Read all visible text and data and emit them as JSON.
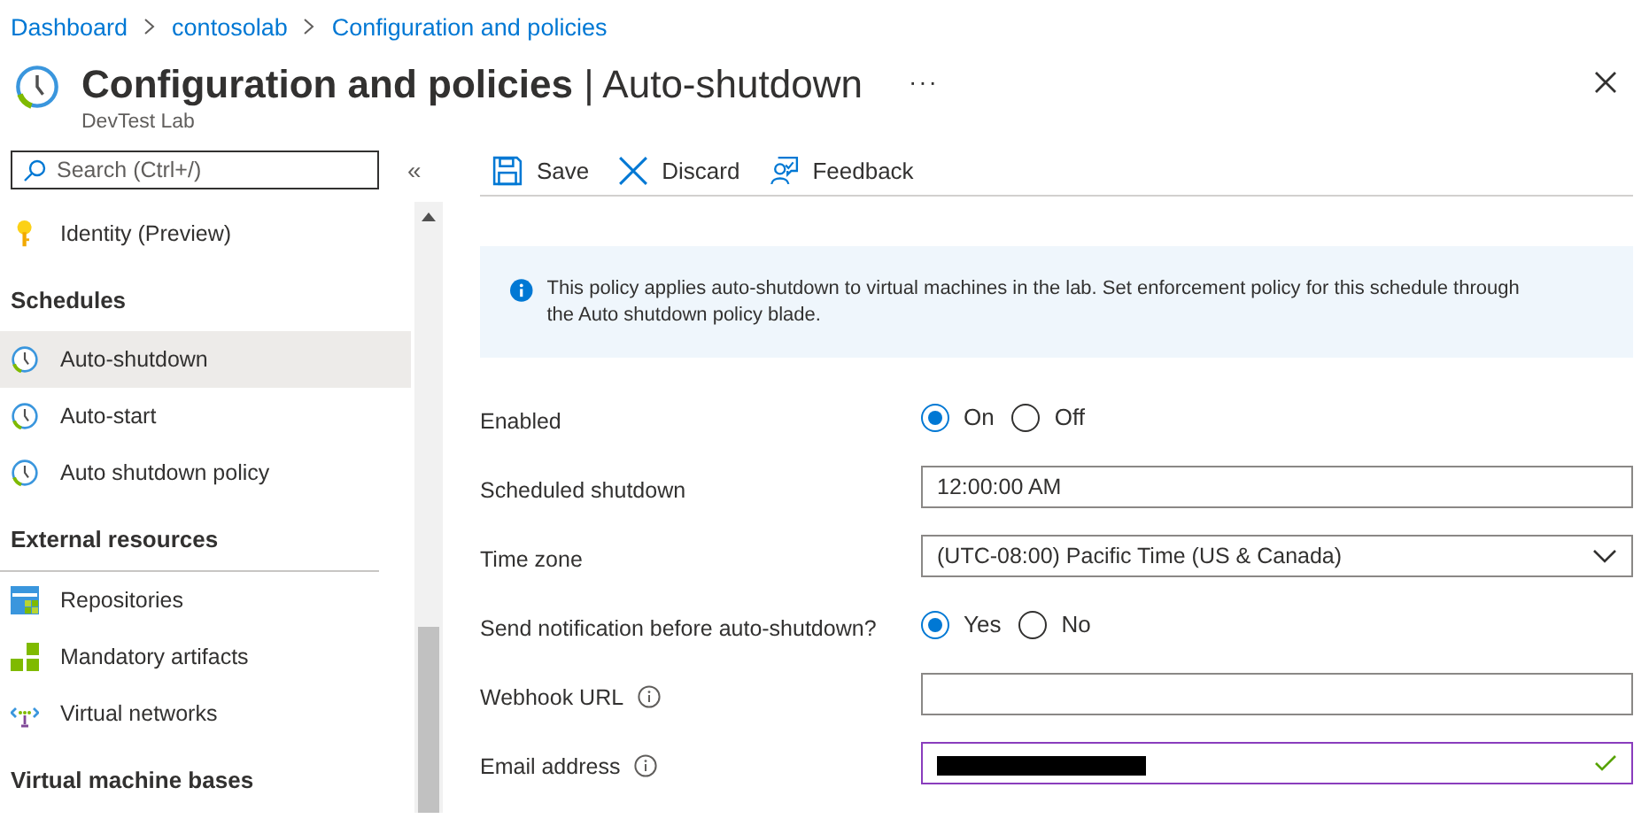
{
  "breadcrumb": [
    {
      "label": "Dashboard"
    },
    {
      "label": "contosolab"
    },
    {
      "label": "Configuration and policies"
    }
  ],
  "header": {
    "title": "Configuration and policies",
    "separator": "|",
    "section": "Auto-shutdown",
    "subtitle": "DevTest Lab",
    "more": "···"
  },
  "sidebar": {
    "search": {
      "placeholder": "Search (Ctrl+/)"
    },
    "collapse": "«",
    "items": [
      {
        "kind": "item",
        "label": "Identity (Preview)",
        "selected": false
      },
      {
        "kind": "header",
        "label": "Schedules"
      },
      {
        "kind": "item",
        "label": "Auto-shutdown",
        "selected": true
      },
      {
        "kind": "item",
        "label": "Auto-start",
        "selected": false
      },
      {
        "kind": "item",
        "label": "Auto shutdown policy",
        "selected": false
      },
      {
        "kind": "header",
        "label": "External resources",
        "divider": true
      },
      {
        "kind": "item",
        "label": "Repositories",
        "selected": false
      },
      {
        "kind": "item",
        "label": "Mandatory artifacts",
        "selected": false
      },
      {
        "kind": "item",
        "label": "Virtual networks",
        "selected": false
      },
      {
        "kind": "header",
        "label": "Virtual machine bases"
      }
    ]
  },
  "toolbar": [
    {
      "label": "Save"
    },
    {
      "label": "Discard"
    },
    {
      "label": "Feedback"
    }
  ],
  "info": {
    "text": "This policy applies auto-shutdown to virtual machines in the lab. Set enforcement policy for this schedule through the Auto shutdown policy blade."
  },
  "form": [
    {
      "kind": "radio",
      "label": "Enabled",
      "info": false,
      "options": [
        {
          "label": "On",
          "selected": true
        },
        {
          "label": "Off",
          "selected": false
        }
      ]
    },
    {
      "kind": "text",
      "label": "Scheduled shutdown",
      "info": false,
      "value": "12:00:00 AM"
    },
    {
      "kind": "select",
      "label": "Time zone",
      "info": false,
      "value": "(UTC-08:00) Pacific Time (US & Canada)"
    },
    {
      "kind": "radio",
      "label": "Send notification before auto-shutdown?",
      "info": false,
      "options": [
        {
          "label": "Yes",
          "selected": true
        },
        {
          "label": "No",
          "selected": false
        }
      ]
    },
    {
      "kind": "text",
      "label": "Webhook URL",
      "info": true
    },
    {
      "kind": "text",
      "label": "Email address",
      "info": true,
      "focused": true,
      "valid": true,
      "redacted": true
    }
  ]
}
